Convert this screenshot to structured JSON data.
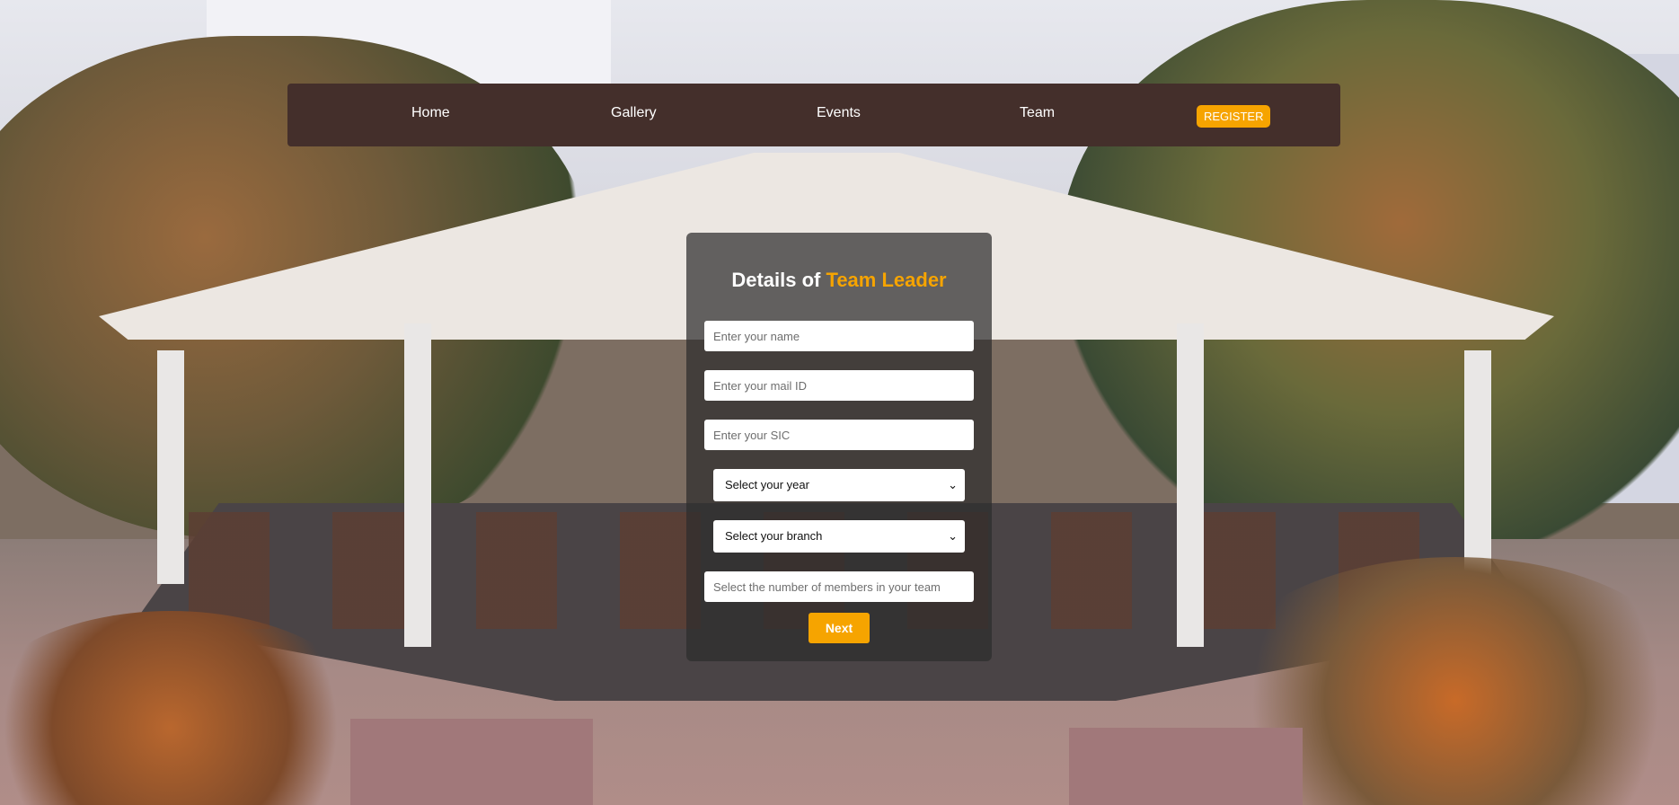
{
  "nav": {
    "items": [
      "Home",
      "Gallery",
      "Events",
      "Team"
    ],
    "register_label": "REGISTER"
  },
  "form": {
    "title_prefix": "Details of",
    "title_accent": "Team Leader",
    "name_placeholder": "Enter your name",
    "mail_placeholder": "Enter your mail ID",
    "sic_placeholder": "Enter your SIC",
    "year_select": "Select your year",
    "branch_select": "Select your branch",
    "members_placeholder": "Select the number of members in your team",
    "next_label": "Next"
  },
  "colors": {
    "navbar_bg": "#442f2b",
    "accent": "#f6a400",
    "card_bg": "rgba(45,45,45,0.72)"
  }
}
